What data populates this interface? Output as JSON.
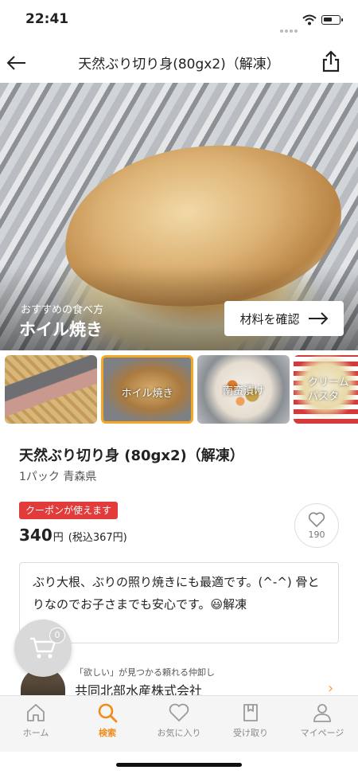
{
  "status_bar": {
    "time": "22:41"
  },
  "header": {
    "title": "天然ぶり切り身(80gx2)（解凍）",
    "back_icon": "back-arrow-icon",
    "share_icon": "share-icon"
  },
  "hero": {
    "subtitle": "おすすめの食べ方",
    "dish": "ホイル焼き",
    "button_label": "材料を確認",
    "button_arrow": "→"
  },
  "recipes": [
    {
      "label": ""
    },
    {
      "label": "ホイル焼き",
      "selected": true
    },
    {
      "label": "南蛮漬け"
    },
    {
      "label": "クリーム\nパスタ"
    }
  ],
  "product": {
    "name": "天然ぶり切り身 (80gx2)（解凍）",
    "meta": "1パック 青森県",
    "coupon": "クーポンが使えます",
    "price": "340",
    "price_unit": "円",
    "price_tax": "(税込367円)",
    "favorites": "190",
    "description": "ぶり大根、ぶりの照り焼きにも最適です。(^-^) 骨とりなのでお子さまでも安心です。😃解凍"
  },
  "cart": {
    "count": "0"
  },
  "seller": {
    "tagline": "「欲しい」が見つかる頼れる仲卸し",
    "name": "共同北部水産株式会社",
    "chevron": "›"
  },
  "bottom_nav": [
    {
      "label": "ホーム",
      "icon": "home-icon"
    },
    {
      "label": "検索",
      "icon": "search-icon",
      "active": true
    },
    {
      "label": "お気に入り",
      "icon": "heart-icon"
    },
    {
      "label": "受け取り",
      "icon": "pickup-icon"
    },
    {
      "label": "マイページ",
      "icon": "person-icon"
    }
  ],
  "colors": {
    "accent": "#f08c1a",
    "coupon": "#e23b3b",
    "selected_border": "#f5a623"
  }
}
